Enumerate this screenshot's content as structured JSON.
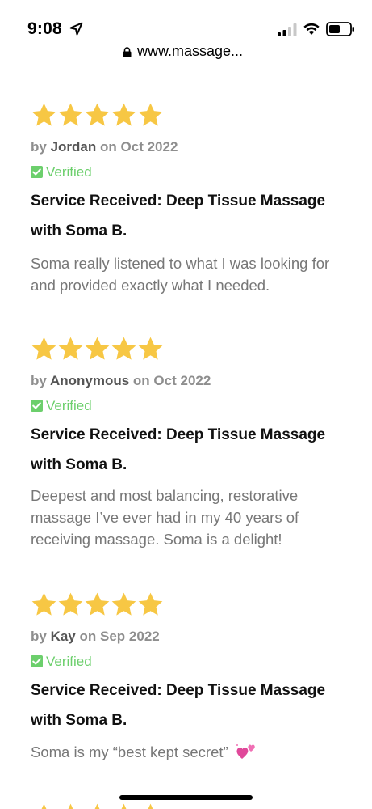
{
  "status_bar": {
    "time": "9:08"
  },
  "browser": {
    "url": "www.massage..."
  },
  "colors": {
    "star": "#f7c744",
    "verified": "#6ccf6c",
    "heart": "#e0489a"
  },
  "reviews": [
    {
      "rating": 5,
      "by_prefix": "by",
      "author": "Jordan",
      "on_prefix": "on",
      "date": "Oct 2022",
      "verified": "Verified",
      "service": "Service Received: Deep Tissue Massage with Soma B.",
      "text": "Soma really listened to what I was looking for and provided exactly what I needed."
    },
    {
      "rating": 5,
      "by_prefix": "by",
      "author": "Anonymous",
      "on_prefix": "on",
      "date": "Oct 2022",
      "verified": "Verified",
      "service": "Service Received: Deep Tissue Massage with Soma B.",
      "text": "Deepest and most balancing, restorative massage I’ve ever had in my 40 years of receiving massage. Soma is a delight!"
    },
    {
      "rating": 5,
      "by_prefix": "by",
      "author": "Kay",
      "on_prefix": "on",
      "date": "Sep 2022",
      "verified": "Verified",
      "service": "Service Received: Deep Tissue Massage with Soma B.",
      "text": "Soma is my “best kept secret”",
      "emoji": "two-hearts-icon"
    }
  ]
}
